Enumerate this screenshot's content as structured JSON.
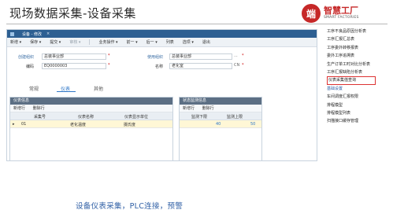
{
  "slide": {
    "title": "现场数据采集-设备采集",
    "caption": "设备仪表采集，PLC连接，预警"
  },
  "logo": {
    "mark": "端",
    "name": "智慧工厂",
    "tagline": "SMART FACTORIES"
  },
  "app": {
    "window_title": "设备 - 修改",
    "close_label": "×",
    "toolbar": [
      {
        "label": "新增 ▾",
        "enabled": true
      },
      {
        "label": "保存 ▾",
        "enabled": true
      },
      {
        "label": "提交 ▾",
        "enabled": true
      },
      {
        "label": "审核 ▾",
        "enabled": false
      },
      {
        "label": "业务操作 ▾",
        "enabled": true
      },
      {
        "label": "前一 ▾",
        "enabled": true
      },
      {
        "label": "后一 ▾",
        "enabled": true
      },
      {
        "label": "列表",
        "enabled": true
      },
      {
        "label": "选项 ▾",
        "enabled": true
      },
      {
        "label": "退出",
        "enabled": true
      }
    ],
    "form": {
      "create_org_label": "创建组织",
      "create_org_value": "总装事业部",
      "use_org_label": "使用组织",
      "use_org_value": "总装事业部",
      "code_label": "编码",
      "code_value": "EQ0000003",
      "name_label": "名称",
      "name_value": "老化室",
      "required_mark": "*",
      "lookup_mark": "...",
      "cn_mark": "CN"
    },
    "tabs": [
      "常规",
      "仪表",
      "其他"
    ],
    "active_tab": "仪表",
    "instrument_panel": {
      "title": "仪表信息",
      "tools": [
        "新增行",
        "删除行"
      ],
      "columns": [
        "采集号",
        "仪表名称",
        "仪表显示单位"
      ],
      "rows": [
        {
          "marker": "▸",
          "collect_no": "01",
          "instrument_name": "老化温度",
          "display_unit": "摄氏度"
        }
      ]
    },
    "monitor_panel": {
      "title": "状态监测信息",
      "tools": [
        "新增行",
        "删除行"
      ],
      "columns": [
        "监测下限",
        "监测上限"
      ],
      "rows": [
        {
          "lower": "40",
          "upper": "50"
        }
      ]
    }
  },
  "side_menu": {
    "items": [
      {
        "label": "工序不良品原因分析表",
        "style": "normal"
      },
      {
        "label": "工序汇报汇总表",
        "style": "normal"
      },
      {
        "label": "工序委外转移报表",
        "style": "normal"
      },
      {
        "label": "委外工序追溯表",
        "style": "normal"
      },
      {
        "label": "生产订单工时对比分析表",
        "style": "normal"
      },
      {
        "label": "工序汇报缺陷分析表",
        "style": "normal"
      },
      {
        "label": "仪表采集值查询",
        "style": "highlight"
      },
      {
        "label": "基础设置",
        "style": "blue"
      },
      {
        "label": "车间调度汇报权限",
        "style": "normal"
      },
      {
        "label": "排程模型",
        "style": "normal"
      },
      {
        "label": "排程模型列表",
        "style": "normal"
      },
      {
        "label": "扫描接口缓存管理",
        "style": "normal"
      }
    ]
  },
  "colors": {
    "accent": "#2f77c7",
    "header_bar": "#2d5f92",
    "panel_head": "#5c6f84",
    "selected_row": "#fff7d6",
    "logo_red": "#c62828",
    "highlight_border": "#dd3333"
  }
}
